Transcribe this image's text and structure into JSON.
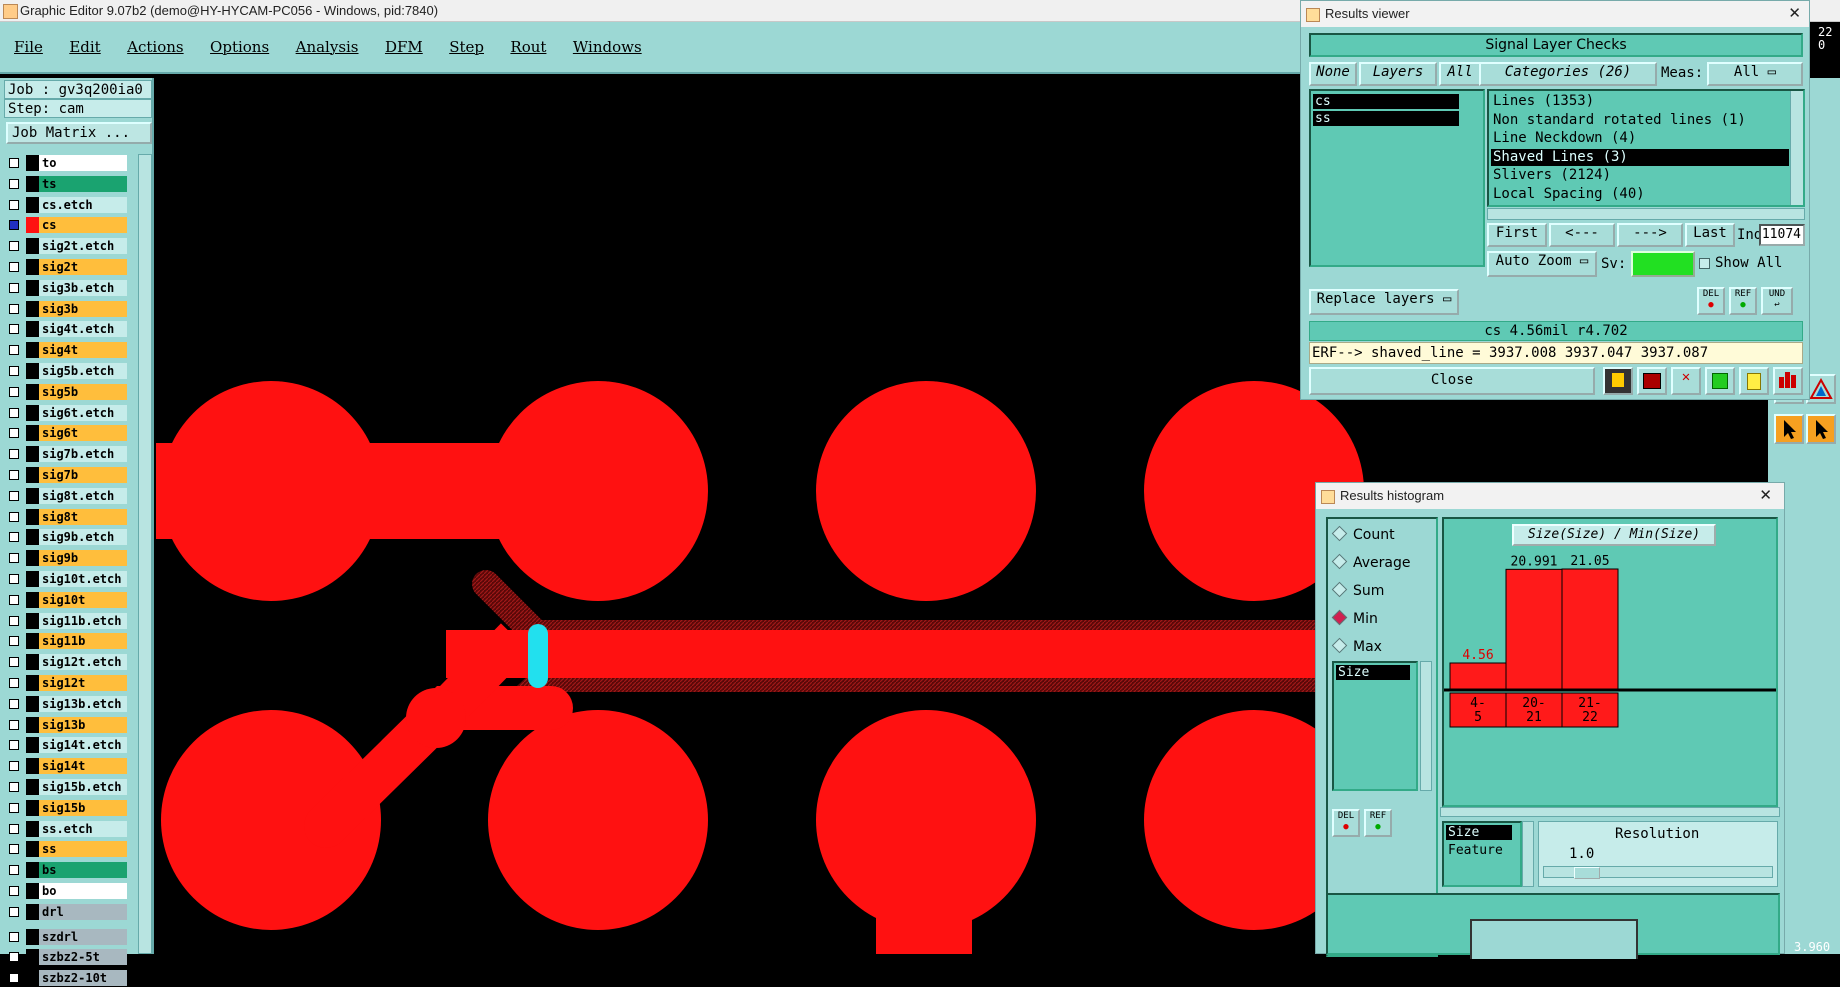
{
  "app": {
    "title": "Graphic Editor 9.07b2 (demo@HY-HYCAM-PC056 - Windows, pid:7840)"
  },
  "menu": [
    "File",
    "Edit",
    "Actions",
    "Options",
    "Analysis",
    "DFM",
    "Step",
    "Rout",
    "Windows"
  ],
  "job": {
    "job_line": "Job : gv3q200ia0",
    "step_line": "Step: cam",
    "matrix_button": "Job Matrix ..."
  },
  "layers": [
    {
      "name": "to",
      "color": "#ffffff"
    },
    {
      "name": "ts",
      "color": "#1aa370"
    },
    {
      "name": "cs.etch",
      "color": "#c6ecea"
    },
    {
      "name": "cs",
      "color": "#ffbe3c",
      "active": true
    },
    {
      "name": "sig2t.etch",
      "color": "#c6ecea"
    },
    {
      "name": "sig2t",
      "color": "#ffbe3c"
    },
    {
      "name": "sig3b.etch",
      "color": "#c6ecea"
    },
    {
      "name": "sig3b",
      "color": "#ffbe3c"
    },
    {
      "name": "sig4t.etch",
      "color": "#c6ecea"
    },
    {
      "name": "sig4t",
      "color": "#ffbe3c"
    },
    {
      "name": "sig5b.etch",
      "color": "#c6ecea"
    },
    {
      "name": "sig5b",
      "color": "#ffbe3c"
    },
    {
      "name": "sig6t.etch",
      "color": "#c6ecea"
    },
    {
      "name": "sig6t",
      "color": "#ffbe3c"
    },
    {
      "name": "sig7b.etch",
      "color": "#c6ecea"
    },
    {
      "name": "sig7b",
      "color": "#ffbe3c"
    },
    {
      "name": "sig8t.etch",
      "color": "#c6ecea"
    },
    {
      "name": "sig8t",
      "color": "#ffbe3c"
    },
    {
      "name": "sig9b.etch",
      "color": "#c6ecea"
    },
    {
      "name": "sig9b",
      "color": "#ffbe3c"
    },
    {
      "name": "sig10t.etch",
      "color": "#c6ecea"
    },
    {
      "name": "sig10t",
      "color": "#ffbe3c"
    },
    {
      "name": "sig11b.etch",
      "color": "#c6ecea"
    },
    {
      "name": "sig11b",
      "color": "#ffbe3c"
    },
    {
      "name": "sig12t.etch",
      "color": "#c6ecea"
    },
    {
      "name": "sig12t",
      "color": "#ffbe3c"
    },
    {
      "name": "sig13b.etch",
      "color": "#c6ecea"
    },
    {
      "name": "sig13b",
      "color": "#ffbe3c"
    },
    {
      "name": "sig14t.etch",
      "color": "#c6ecea"
    },
    {
      "name": "sig14t",
      "color": "#ffbe3c"
    },
    {
      "name": "sig15b.etch",
      "color": "#c6ecea"
    },
    {
      "name": "sig15b",
      "color": "#ffbe3c"
    },
    {
      "name": "ss.etch",
      "color": "#c6ecea"
    },
    {
      "name": "ss",
      "color": "#ffbe3c"
    },
    {
      "name": "bs",
      "color": "#1aa370"
    },
    {
      "name": "bo",
      "color": "#ffffff"
    },
    {
      "name": "drl",
      "color": "#a8b8c0"
    },
    {
      "name": "szdrl",
      "color": "#a8b8c0"
    },
    {
      "name": "szbz2-5t",
      "color": "#a8b8c0"
    },
    {
      "name": "szbz2-10t",
      "color": "#a8b8c0"
    }
  ],
  "results_viewer": {
    "title": "Results viewer",
    "header": "Signal Layer Checks",
    "none_btn": "None",
    "layers_btn": "Layers",
    "all_btn": "All",
    "layer_items": [
      "cs",
      "ss"
    ],
    "categories_label": "Categories (26)",
    "meas_label": "Meas:",
    "meas_value": "All",
    "categories": [
      "Lines (1353)",
      "Non standard rotated lines (1)",
      "Line Neckdown (4)",
      "Shaved Lines (3)",
      "Slivers (2124)",
      "Local Spacing (40)"
    ],
    "selected_category": 3,
    "first_btn": "First",
    "prev_btn": "<---",
    "next_btn": "--->",
    "last_btn": "Last",
    "index_label": "Index:",
    "index_value": "11074",
    "auto_zoom": "Auto Zoom",
    "sv_label": "Sv:",
    "show_all": "Show All",
    "replace_layers": "Replace layers",
    "del_label": "DEL",
    "ref_label": "REF",
    "und_label": "UND",
    "status": "cs 4.56mil  r4.702",
    "erf": "ERF--> shaved_line = 3937.008 3937.047 3937.087",
    "close_btn": "Close"
  },
  "histogram": {
    "title": "Results histogram",
    "options": [
      "Count",
      "Average",
      "Sum",
      "Min",
      "Max"
    ],
    "selected_option": "Min",
    "x_field": "Size",
    "chart_title": "Size(Size) / Min(Size)",
    "bars": [
      {
        "label": "4-\n5",
        "value": 4.56
      },
      {
        "label": "20-\n21",
        "value": 20.991
      },
      {
        "label": "21-\n22",
        "value": 21.05
      }
    ],
    "bar_value_labels": [
      "4.56",
      "20.991",
      "21.05"
    ],
    "bar_range_labels": [
      [
        "4-",
        "5"
      ],
      [
        "20-",
        "21"
      ],
      [
        "21-",
        "22"
      ]
    ],
    "list_items": [
      "Size",
      "Feature"
    ],
    "resolution_label": "Resolution",
    "resolution_value": "1.0",
    "del_label": "DEL",
    "ref_label": "REF"
  },
  "corner": {
    "top_right": "22\n0",
    "top_right_a": "22",
    "top_right_b": "0",
    "bottom_right": "3.960"
  },
  "colors": {
    "pad_red": "#ff1111",
    "shaved": "#7a1010",
    "highlight": "#22e0ee",
    "panel_bg": "#9cd8d4",
    "list_bg": "#5fc9b4"
  }
}
